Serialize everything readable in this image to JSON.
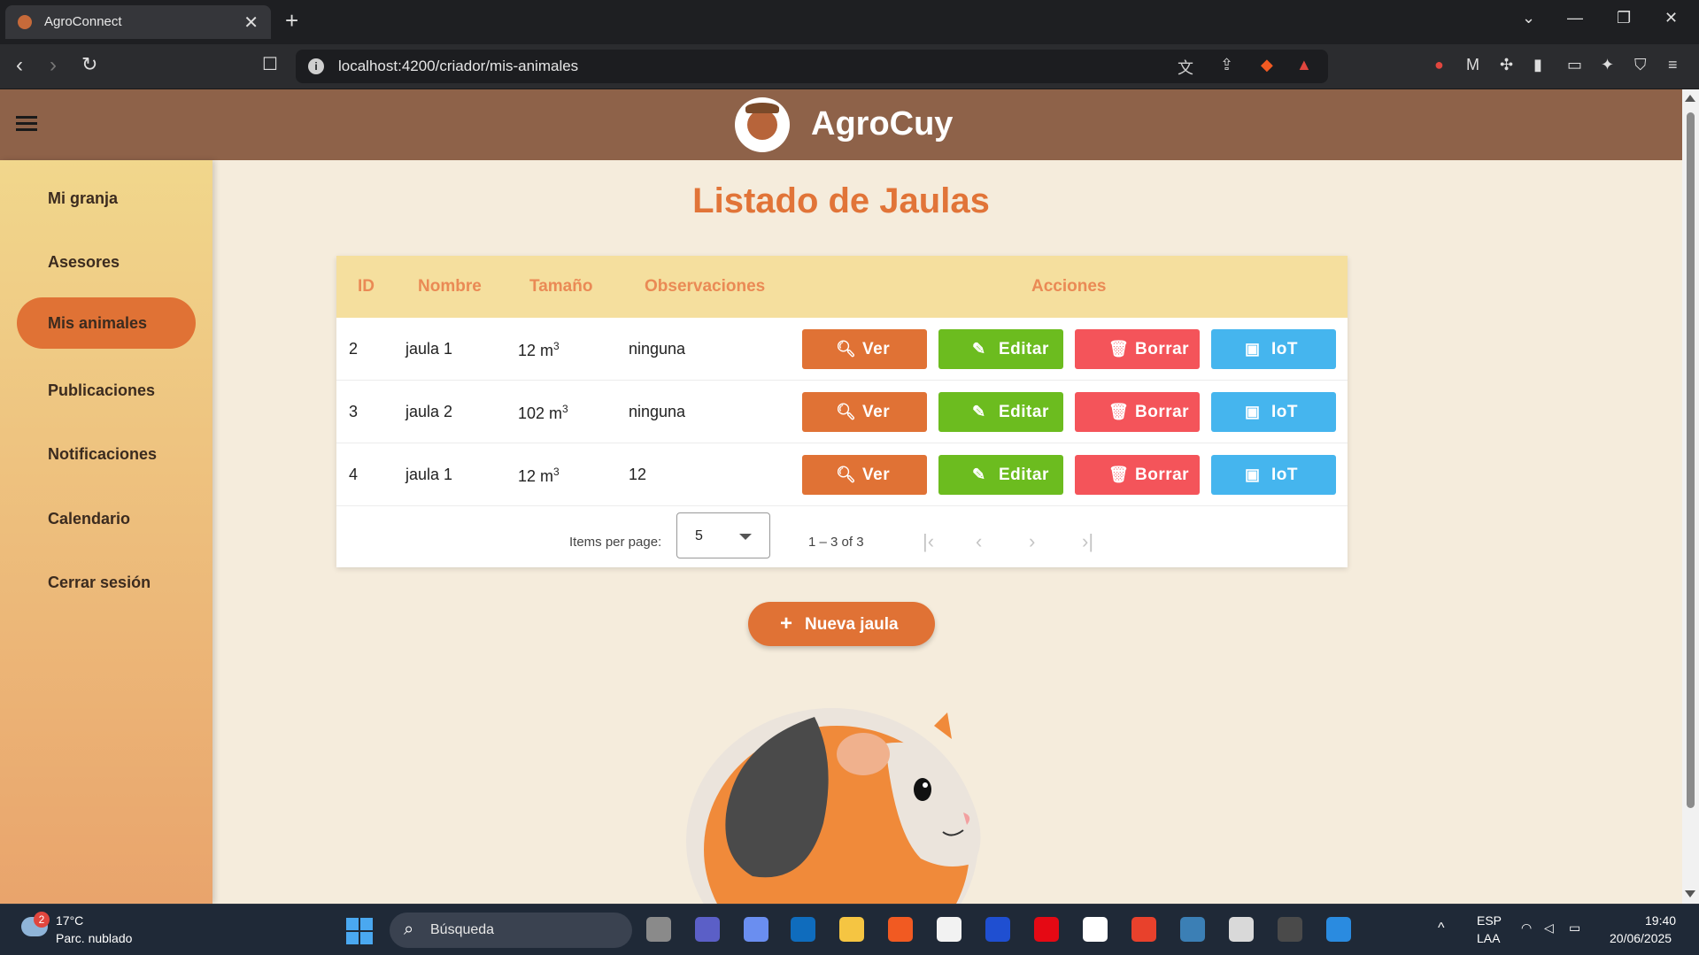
{
  "browser": {
    "tab_title": "AgroConnect",
    "url": "localhost:4200/criador/mis-animales",
    "new_tab": "+",
    "close_tab": "✕"
  },
  "app": {
    "title": "AgroCuy"
  },
  "sidebar": {
    "items": [
      {
        "label": "Mi granja"
      },
      {
        "label": "Asesores"
      },
      {
        "label": "Mis animales"
      },
      {
        "label": "Publicaciones"
      },
      {
        "label": "Notificaciones"
      },
      {
        "label": "Calendario"
      },
      {
        "label": "Cerrar sesión"
      }
    ],
    "active": "Mis animales"
  },
  "page": {
    "title": "Listado de Jaulas"
  },
  "table": {
    "headers": {
      "id": "ID",
      "name": "Nombre",
      "size": "Tamaño",
      "obs": "Observaciones",
      "actions": "Acciones"
    },
    "rows": [
      {
        "id": "2",
        "name": "jaula 1",
        "size": "12 m",
        "obs": "ninguna"
      },
      {
        "id": "3",
        "name": "jaula 2",
        "size": "102 m",
        "obs": "ninguna"
      },
      {
        "id": "4",
        "name": "jaula 1",
        "size": "12 m",
        "obs": "12"
      }
    ],
    "size_exponent": "3",
    "actions": {
      "view": "Ver",
      "edit": "Editar",
      "delete": "Borrar",
      "iot": "IoT"
    }
  },
  "paginator": {
    "items_per_page_label": "Items per page:",
    "items_per_page_value": "5",
    "range": "1 – 3 of 3"
  },
  "new_button": {
    "label": "Nueva jaula"
  },
  "taskbar": {
    "weather_badge": "2",
    "temperature": "17°C",
    "weather": "Parc. nublado",
    "search_placeholder": "Búsqueda",
    "lang_1": "ESP",
    "lang_2": "LAA",
    "time": "19:40",
    "date": "20/06/2025"
  },
  "colors": {
    "accent": "#e07235",
    "header": "#8e6249",
    "edit": "#6cbc1f",
    "delete": "#f4545a",
    "iot": "#45b5ee",
    "table_header": "#f5df9e"
  }
}
